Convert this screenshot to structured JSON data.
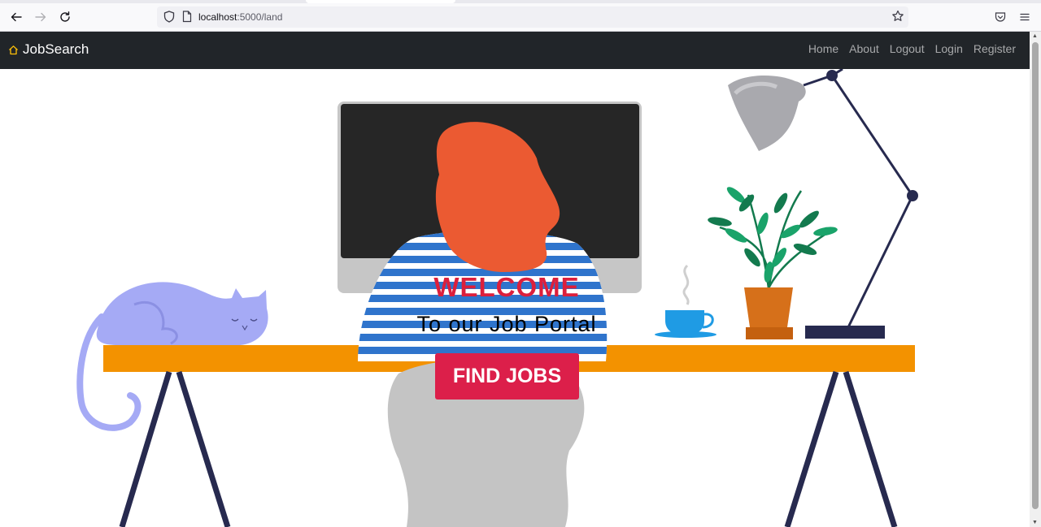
{
  "browser": {
    "url_host": "localhost",
    "url_path": ":5000/land"
  },
  "navbar": {
    "brand": "JobSearch",
    "links": [
      "Home",
      "About",
      "Logout",
      "Login",
      "Register"
    ]
  },
  "hero": {
    "welcome": "WELCOME",
    "subtitle": "To our Job Portal",
    "cta": "FIND JOBS"
  },
  "colors": {
    "navbar_bg": "#212529",
    "welcome_text": "#dc1f3c",
    "cta_bg": "#dc1f4a",
    "desk": "#f39200",
    "hair": "#eb5a32",
    "cat": "#a5aaf5"
  },
  "icons": [
    "back-arrow-icon",
    "forward-arrow-icon",
    "reload-icon",
    "shield-icon",
    "page-icon",
    "star-icon",
    "pocket-icon",
    "menu-icon",
    "home-icon"
  ]
}
